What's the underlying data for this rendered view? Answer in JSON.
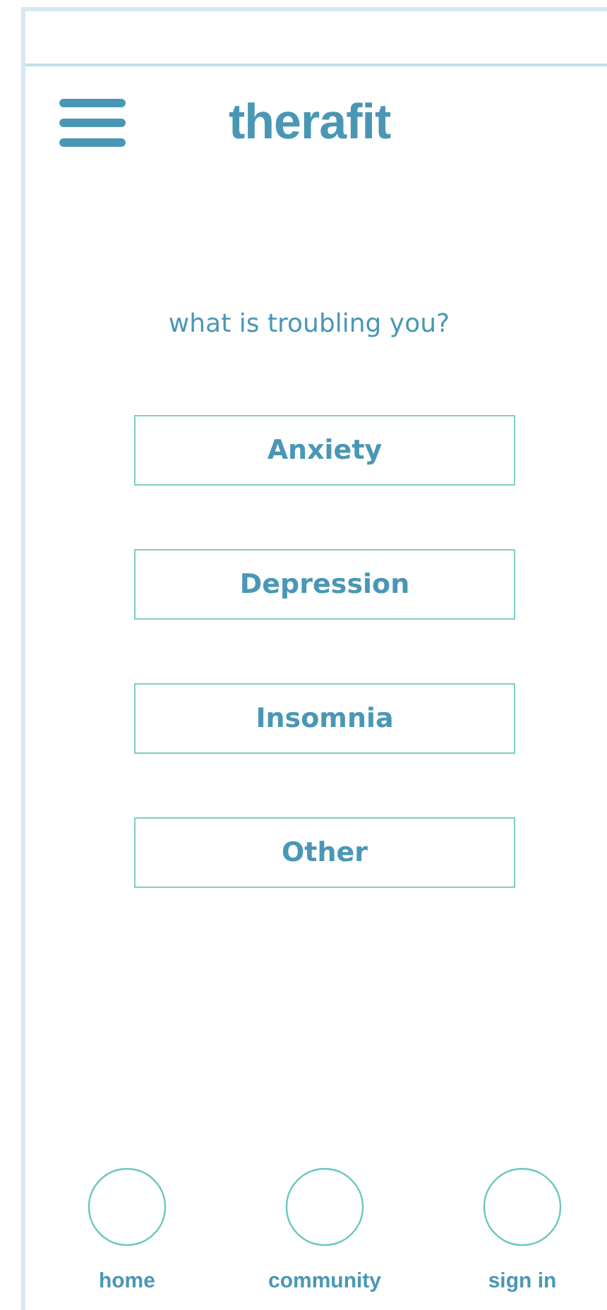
{
  "header": {
    "logo": "therafit"
  },
  "question": "what is troubling you?",
  "options": [
    {
      "label": "Anxiety"
    },
    {
      "label": "Depression"
    },
    {
      "label": "Insomnia"
    },
    {
      "label": "Other"
    }
  ],
  "nav": [
    {
      "label": "home"
    },
    {
      "label": "community"
    },
    {
      "label": "sign in"
    }
  ]
}
